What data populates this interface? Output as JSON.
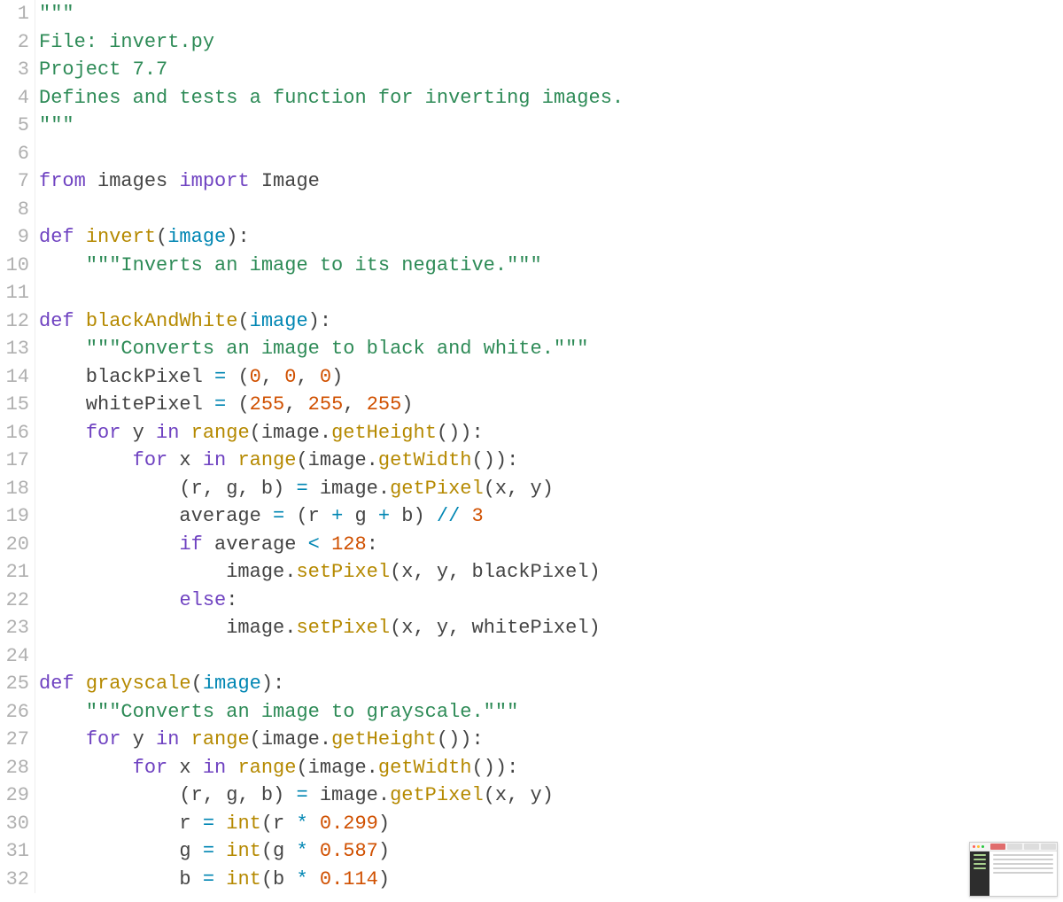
{
  "lineNumbers": [
    "1",
    "2",
    "3",
    "4",
    "5",
    "6",
    "7",
    "8",
    "9",
    "10",
    "11",
    "12",
    "13",
    "14",
    "15",
    "16",
    "17",
    "18",
    "19",
    "20",
    "21",
    "22",
    "23",
    "24",
    "25",
    "26",
    "27",
    "28",
    "29",
    "30",
    "31",
    "32"
  ],
  "code": {
    "l1": [
      {
        "t": "\"\"\"",
        "c": "tok-str"
      }
    ],
    "l2": [
      {
        "t": "File: invert.py",
        "c": "tok-str"
      }
    ],
    "l3": [
      {
        "t": "Project 7.7",
        "c": "tok-str"
      }
    ],
    "l4": [
      {
        "t": "Defines and tests a function for inverting images.",
        "c": "tok-str"
      }
    ],
    "l5": [
      {
        "t": "\"\"\"",
        "c": "tok-str"
      }
    ],
    "l6": [
      {
        "t": "",
        "c": "tok-plain"
      }
    ],
    "l7": [
      {
        "t": "from",
        "c": "tok-kw"
      },
      {
        "t": " images ",
        "c": "tok-plain"
      },
      {
        "t": "import",
        "c": "tok-kw"
      },
      {
        "t": " Image",
        "c": "tok-plain"
      }
    ],
    "l8": [
      {
        "t": "",
        "c": "tok-plain"
      }
    ],
    "l9": [
      {
        "t": "def",
        "c": "tok-kw"
      },
      {
        "t": " ",
        "c": "tok-plain"
      },
      {
        "t": "invert",
        "c": "tok-func"
      },
      {
        "t": "(",
        "c": "tok-punct"
      },
      {
        "t": "image",
        "c": "tok-param"
      },
      {
        "t": "):",
        "c": "tok-punct"
      }
    ],
    "l10": [
      {
        "t": "    ",
        "c": "tok-plain"
      },
      {
        "t": "\"\"\"Inverts an image to its negative.\"\"\"",
        "c": "tok-str"
      }
    ],
    "l11": [
      {
        "t": "",
        "c": "tok-plain"
      }
    ],
    "l12": [
      {
        "t": "def",
        "c": "tok-kw"
      },
      {
        "t": " ",
        "c": "tok-plain"
      },
      {
        "t": "blackAndWhite",
        "c": "tok-func"
      },
      {
        "t": "(",
        "c": "tok-punct"
      },
      {
        "t": "image",
        "c": "tok-param"
      },
      {
        "t": "):",
        "c": "tok-punct"
      }
    ],
    "l13": [
      {
        "t": "    ",
        "c": "tok-plain"
      },
      {
        "t": "\"\"\"Converts an image to black and white.\"\"\"",
        "c": "tok-str"
      }
    ],
    "l14": [
      {
        "t": "    blackPixel ",
        "c": "tok-plain"
      },
      {
        "t": "=",
        "c": "tok-op"
      },
      {
        "t": " (",
        "c": "tok-punct"
      },
      {
        "t": "0",
        "c": "tok-num"
      },
      {
        "t": ", ",
        "c": "tok-punct"
      },
      {
        "t": "0",
        "c": "tok-num"
      },
      {
        "t": ", ",
        "c": "tok-punct"
      },
      {
        "t": "0",
        "c": "tok-num"
      },
      {
        "t": ")",
        "c": "tok-punct"
      }
    ],
    "l15": [
      {
        "t": "    whitePixel ",
        "c": "tok-plain"
      },
      {
        "t": "=",
        "c": "tok-op"
      },
      {
        "t": " (",
        "c": "tok-punct"
      },
      {
        "t": "255",
        "c": "tok-num"
      },
      {
        "t": ", ",
        "c": "tok-punct"
      },
      {
        "t": "255",
        "c": "tok-num"
      },
      {
        "t": ", ",
        "c": "tok-punct"
      },
      {
        "t": "255",
        "c": "tok-num"
      },
      {
        "t": ")",
        "c": "tok-punct"
      }
    ],
    "l16": [
      {
        "t": "    ",
        "c": "tok-plain"
      },
      {
        "t": "for",
        "c": "tok-kw"
      },
      {
        "t": " y ",
        "c": "tok-plain"
      },
      {
        "t": "in",
        "c": "tok-kw"
      },
      {
        "t": " ",
        "c": "tok-plain"
      },
      {
        "t": "range",
        "c": "tok-func"
      },
      {
        "t": "(image.",
        "c": "tok-plain"
      },
      {
        "t": "getHeight",
        "c": "tok-func"
      },
      {
        "t": "()):",
        "c": "tok-punct"
      }
    ],
    "l17": [
      {
        "t": "        ",
        "c": "tok-plain"
      },
      {
        "t": "for",
        "c": "tok-kw"
      },
      {
        "t": " x ",
        "c": "tok-plain"
      },
      {
        "t": "in",
        "c": "tok-kw"
      },
      {
        "t": " ",
        "c": "tok-plain"
      },
      {
        "t": "range",
        "c": "tok-func"
      },
      {
        "t": "(image.",
        "c": "tok-plain"
      },
      {
        "t": "getWidth",
        "c": "tok-func"
      },
      {
        "t": "()):",
        "c": "tok-punct"
      }
    ],
    "l18": [
      {
        "t": "            (r, g, b) ",
        "c": "tok-plain"
      },
      {
        "t": "=",
        "c": "tok-op"
      },
      {
        "t": " image.",
        "c": "tok-plain"
      },
      {
        "t": "getPixel",
        "c": "tok-func"
      },
      {
        "t": "(x, y)",
        "c": "tok-punct"
      }
    ],
    "l19": [
      {
        "t": "            average ",
        "c": "tok-plain"
      },
      {
        "t": "=",
        "c": "tok-op"
      },
      {
        "t": " (r ",
        "c": "tok-plain"
      },
      {
        "t": "+",
        "c": "tok-op"
      },
      {
        "t": " g ",
        "c": "tok-plain"
      },
      {
        "t": "+",
        "c": "tok-op"
      },
      {
        "t": " b) ",
        "c": "tok-plain"
      },
      {
        "t": "//",
        "c": "tok-op"
      },
      {
        "t": " ",
        "c": "tok-plain"
      },
      {
        "t": "3",
        "c": "tok-num"
      }
    ],
    "l20": [
      {
        "t": "            ",
        "c": "tok-plain"
      },
      {
        "t": "if",
        "c": "tok-kw"
      },
      {
        "t": " average ",
        "c": "tok-plain"
      },
      {
        "t": "<",
        "c": "tok-op"
      },
      {
        "t": " ",
        "c": "tok-plain"
      },
      {
        "t": "128",
        "c": "tok-num"
      },
      {
        "t": ":",
        "c": "tok-punct"
      }
    ],
    "l21": [
      {
        "t": "                image.",
        "c": "tok-plain"
      },
      {
        "t": "setPixel",
        "c": "tok-func"
      },
      {
        "t": "(x, y, blackPixel)",
        "c": "tok-punct"
      }
    ],
    "l22": [
      {
        "t": "            ",
        "c": "tok-plain"
      },
      {
        "t": "else",
        "c": "tok-kw"
      },
      {
        "t": ":",
        "c": "tok-punct"
      }
    ],
    "l23": [
      {
        "t": "                image.",
        "c": "tok-plain"
      },
      {
        "t": "setPixel",
        "c": "tok-func"
      },
      {
        "t": "(x, y, whitePixel)",
        "c": "tok-punct"
      }
    ],
    "l24": [
      {
        "t": "",
        "c": "tok-plain"
      }
    ],
    "l25": [
      {
        "t": "def",
        "c": "tok-kw"
      },
      {
        "t": " ",
        "c": "tok-plain"
      },
      {
        "t": "grayscale",
        "c": "tok-func"
      },
      {
        "t": "(",
        "c": "tok-punct"
      },
      {
        "t": "image",
        "c": "tok-param"
      },
      {
        "t": "):",
        "c": "tok-punct"
      }
    ],
    "l26": [
      {
        "t": "    ",
        "c": "tok-plain"
      },
      {
        "t": "\"\"\"Converts an image to grayscale.\"\"\"",
        "c": "tok-str"
      }
    ],
    "l27": [
      {
        "t": "    ",
        "c": "tok-plain"
      },
      {
        "t": "for",
        "c": "tok-kw"
      },
      {
        "t": " y ",
        "c": "tok-plain"
      },
      {
        "t": "in",
        "c": "tok-kw"
      },
      {
        "t": " ",
        "c": "tok-plain"
      },
      {
        "t": "range",
        "c": "tok-func"
      },
      {
        "t": "(image.",
        "c": "tok-plain"
      },
      {
        "t": "getHeight",
        "c": "tok-func"
      },
      {
        "t": "()):",
        "c": "tok-punct"
      }
    ],
    "l28": [
      {
        "t": "        ",
        "c": "tok-plain"
      },
      {
        "t": "for",
        "c": "tok-kw"
      },
      {
        "t": " x ",
        "c": "tok-plain"
      },
      {
        "t": "in",
        "c": "tok-kw"
      },
      {
        "t": " ",
        "c": "tok-plain"
      },
      {
        "t": "range",
        "c": "tok-func"
      },
      {
        "t": "(image.",
        "c": "tok-plain"
      },
      {
        "t": "getWidth",
        "c": "tok-func"
      },
      {
        "t": "()):",
        "c": "tok-punct"
      }
    ],
    "l29": [
      {
        "t": "            (r, g, b) ",
        "c": "tok-plain"
      },
      {
        "t": "=",
        "c": "tok-op"
      },
      {
        "t": " image.",
        "c": "tok-plain"
      },
      {
        "t": "getPixel",
        "c": "tok-func"
      },
      {
        "t": "(x, y)",
        "c": "tok-punct"
      }
    ],
    "l30": [
      {
        "t": "            r ",
        "c": "tok-plain"
      },
      {
        "t": "=",
        "c": "tok-op"
      },
      {
        "t": " ",
        "c": "tok-plain"
      },
      {
        "t": "int",
        "c": "tok-func"
      },
      {
        "t": "(r ",
        "c": "tok-plain"
      },
      {
        "t": "*",
        "c": "tok-op"
      },
      {
        "t": " ",
        "c": "tok-plain"
      },
      {
        "t": "0.299",
        "c": "tok-num"
      },
      {
        "t": ")",
        "c": "tok-punct"
      }
    ],
    "l31": [
      {
        "t": "            g ",
        "c": "tok-plain"
      },
      {
        "t": "=",
        "c": "tok-op"
      },
      {
        "t": " ",
        "c": "tok-plain"
      },
      {
        "t": "int",
        "c": "tok-func"
      },
      {
        "t": "(g ",
        "c": "tok-plain"
      },
      {
        "t": "*",
        "c": "tok-op"
      },
      {
        "t": " ",
        "c": "tok-plain"
      },
      {
        "t": "0.587",
        "c": "tok-num"
      },
      {
        "t": ")",
        "c": "tok-punct"
      }
    ],
    "l32": [
      {
        "t": "            b ",
        "c": "tok-plain"
      },
      {
        "t": "=",
        "c": "tok-op"
      },
      {
        "t": " ",
        "c": "tok-plain"
      },
      {
        "t": "int",
        "c": "tok-func"
      },
      {
        "t": "(b ",
        "c": "tok-plain"
      },
      {
        "t": "*",
        "c": "tok-op"
      },
      {
        "t": " ",
        "c": "tok-plain"
      },
      {
        "t": "0.114",
        "c": "tok-num"
      },
      {
        "t": ")",
        "c": "tok-punct"
      }
    ]
  }
}
